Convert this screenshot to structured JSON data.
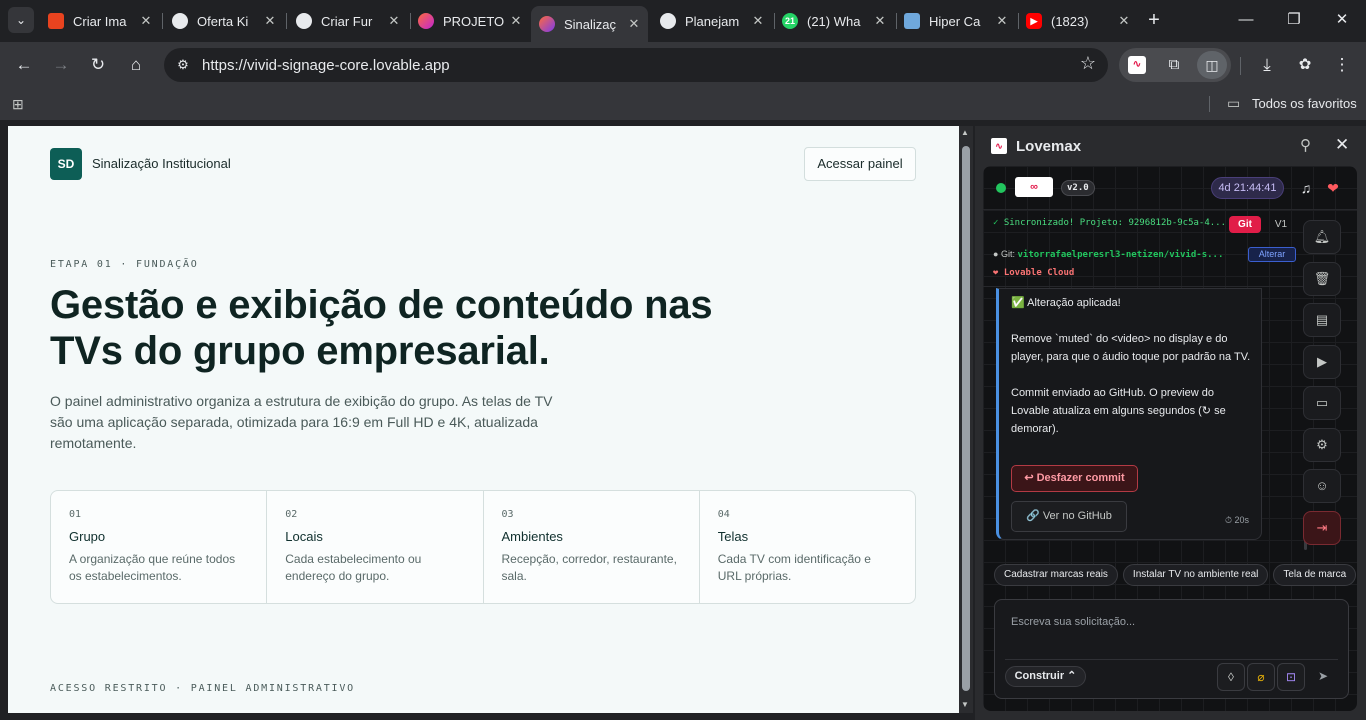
{
  "tabs": [
    {
      "title": "Criar Ima",
      "favicon_color": "#e8431f",
      "favicon_text": "",
      "active": false
    },
    {
      "title": "Oferta Ki",
      "favicon_color": "#5f6368",
      "favicon_text": "",
      "active": false
    },
    {
      "title": "Criar Fur",
      "favicon_color": "#5f6368",
      "favicon_text": "",
      "active": false
    },
    {
      "title": "PROJETO",
      "favicon_color": "#e64aa0",
      "favicon_text": "",
      "active": false
    },
    {
      "title": "Sinalizaç",
      "favicon_color": "#a855f7",
      "favicon_text": "",
      "active": true
    },
    {
      "title": "Planejam",
      "favicon_color": "#5f6368",
      "favicon_text": "",
      "active": false
    },
    {
      "title": "(21) Wha",
      "favicon_color": "#25d366",
      "favicon_text": "21",
      "active": false
    },
    {
      "title": "Hiper Ca",
      "favicon_color": "#6fa8dc",
      "favicon_text": "",
      "active": false
    },
    {
      "title": "(1823) ",
      "favicon_color": "#ff0000",
      "favicon_text": "",
      "active": false
    }
  ],
  "browser": {
    "url": "https://vivid-signage-core.lovable.app",
    "bookmarks_all": "Todos os favoritos"
  },
  "page": {
    "brand_initials": "SD",
    "brand_name": "Sinalização Institucional",
    "access_button": "Acessar painel",
    "eyebrow": "ETAPA 01 · FUNDAÇÃO",
    "title": "Gestão e exibição de conteúdo nas TVs do grupo empresarial.",
    "description": "O painel administrativo organiza a estrutura de exibição do grupo. As telas de TV são uma aplicação separada, otimizada para 16:9 em Full HD e 4K, atualizada remotamente.",
    "steps": [
      {
        "num": "01",
        "name": "Grupo",
        "desc": "A organização que reúne todos os estabelecimentos."
      },
      {
        "num": "02",
        "name": "Locais",
        "desc": "Cada estabelecimento ou endereço do grupo."
      },
      {
        "num": "03",
        "name": "Ambientes",
        "desc": "Recepção, corredor, restaurante, sala."
      },
      {
        "num": "04",
        "name": "Telas",
        "desc": "Cada TV com identificação e URL próprias."
      }
    ],
    "footer": "ACESSO RESTRITO · PAINEL ADMINISTRATIVO"
  },
  "sidepanel": {
    "title": "Lovemax",
    "version": "v2.0",
    "timer": "4d 21:44:41",
    "sync_label": "Sincronizado! Projeto: 9296812b-9c5a-4...",
    "git_badge": "Git",
    "v1_badge": "V1",
    "git_label": "Git:",
    "git_repo": "vitorrafaelperesrl3-netizen/vivid-s...",
    "alterar": "Alterar",
    "cloud": "Lovable Cloud",
    "message": {
      "line1": "Alteração aplicada!",
      "line2": "Remove `muted` do <video> no display e do player, para que o áudio toque por padrão na TV.",
      "line3": "Commit enviado ao GitHub. O preview do Lovable atualiza em alguns segundos (↻ se demorar).",
      "undo": "Desfazer commit",
      "github": "Ver no GitHub",
      "elapsed": "20s"
    },
    "chips": [
      "Cadastrar marcas reais",
      "Instalar TV no ambiente real",
      "Tela de marca"
    ],
    "composer_placeholder": "Escreva sua solicitação...",
    "mode": "Construir"
  }
}
